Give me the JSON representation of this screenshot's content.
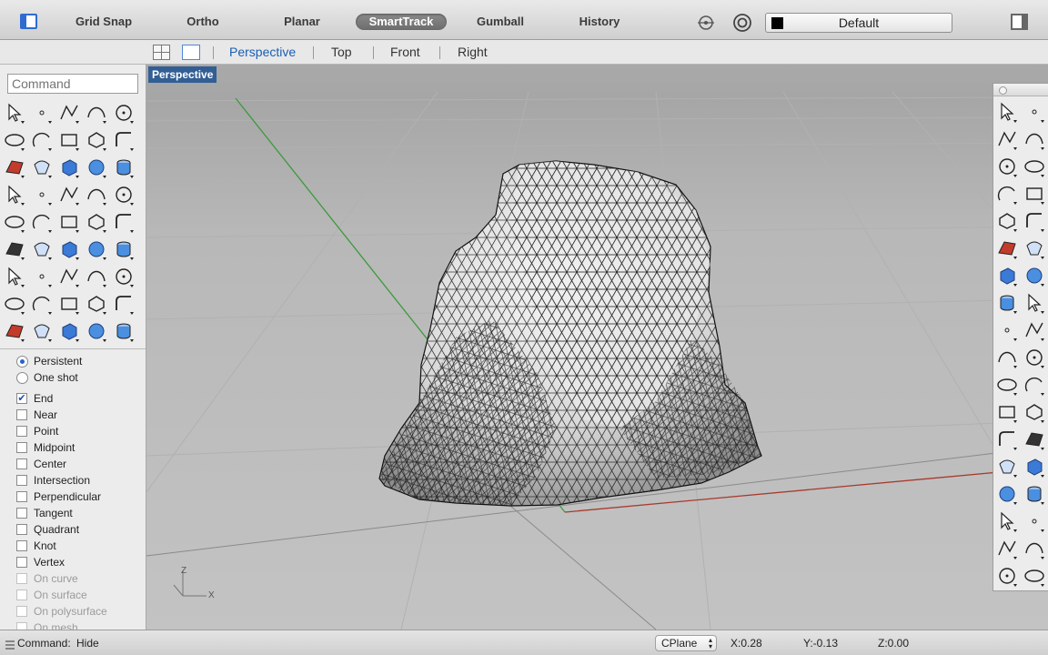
{
  "toolbar": {
    "buttons": [
      "Grid Snap",
      "Ortho",
      "Planar",
      "SmartTrack",
      "Gumball",
      "History"
    ],
    "active": "SmartTrack",
    "layer_name": "Default",
    "icons": [
      "sidebar-toggle-icon",
      "osnap-disc-icon",
      "record-icon",
      "layer-color-swatch",
      "panels-toggle-icon"
    ]
  },
  "viewtabs": {
    "tabs": [
      "Perspective",
      "Top",
      "Front",
      "Right"
    ],
    "active": "Perspective"
  },
  "command": {
    "placeholder": "Command"
  },
  "viewport": {
    "label": "Perspective",
    "axis_z": "Z",
    "axis_x": "X"
  },
  "osnap": {
    "modes": [
      {
        "label": "Persistent",
        "type": "radio",
        "checked": true
      },
      {
        "label": "One shot",
        "type": "radio",
        "checked": false
      }
    ],
    "items": [
      {
        "label": "End",
        "checked": true,
        "enabled": true
      },
      {
        "label": "Near",
        "checked": false,
        "enabled": true
      },
      {
        "label": "Point",
        "checked": false,
        "enabled": true
      },
      {
        "label": "Midpoint",
        "checked": false,
        "enabled": true
      },
      {
        "label": "Center",
        "checked": false,
        "enabled": true
      },
      {
        "label": "Intersection",
        "checked": false,
        "enabled": true
      },
      {
        "label": "Perpendicular",
        "checked": false,
        "enabled": true
      },
      {
        "label": "Tangent",
        "checked": false,
        "enabled": true
      },
      {
        "label": "Quadrant",
        "checked": false,
        "enabled": true
      },
      {
        "label": "Knot",
        "checked": false,
        "enabled": true
      },
      {
        "label": "Vertex",
        "checked": false,
        "enabled": true
      },
      {
        "label": "On curve",
        "checked": false,
        "enabled": false
      },
      {
        "label": "On surface",
        "checked": false,
        "enabled": false
      },
      {
        "label": "On polysurface",
        "checked": false,
        "enabled": false
      },
      {
        "label": "On mesh",
        "checked": false,
        "enabled": false
      }
    ]
  },
  "tools": {
    "left_icons": [
      "select-icon",
      "point-icon",
      "polyline-icon",
      "curve-icon",
      "circle-icon",
      "ellipse-icon",
      "arc-icon",
      "rectangle-icon",
      "polygon-icon",
      "fillet-icon",
      "surface-icon",
      "sweep-icon",
      "box-icon",
      "sphere-icon",
      "cylinder-icon",
      "mesh-icon",
      "gear-icon",
      "explode-icon",
      "trim-icon",
      "split-icon",
      "boolean-icon",
      "group-icon",
      "blend-icon",
      "project-icon",
      "text-icon",
      "transform-icon",
      "array-icon",
      "align-icon",
      "orient-icon",
      "solid-edit-icon",
      "grid-icon",
      "dimension-icon",
      "analyze-icon",
      "check-icon",
      "edge-icon",
      "pan-icon",
      "zoom-in-icon",
      "zoom-window-icon",
      "zoom-extents-icon",
      "zoom-selected-icon",
      "rotate-view-icon",
      "car-icon",
      "render-icon",
      "paint-icon",
      "light-icon"
    ],
    "right_icons": [
      "select-icon",
      "point-icon",
      "polyline-icon",
      "curve-icon",
      "circle-icon",
      "ellipse-icon",
      "arc-icon",
      "rectangle-icon",
      "polygon-icon",
      "fillet-icon",
      "surface-icon",
      "sweep-icon",
      "box-icon",
      "sphere-icon",
      "cylinder-icon",
      "mesh-icon",
      "gear-icon",
      "explode-icon",
      "trim-icon",
      "split-icon",
      "boolean-icon",
      "group-icon",
      "blend-icon",
      "project-icon",
      "text-icon",
      "transform-icon",
      "array-icon",
      "align-icon",
      "orient-icon",
      "solid-edit-icon",
      "grid-icon",
      "dimension-icon",
      "analyze-icon",
      "check-icon",
      "edge-icon",
      "paint-icon"
    ]
  },
  "status": {
    "command_label": "Command:",
    "command_value": "Hide",
    "cplane": "CPlane",
    "x": "X:0.28",
    "y": "Y:-0.13",
    "z": "Z:0.00"
  },
  "colors": {
    "active_tab": "#1a5fb4",
    "viewport_label_bg": "#325e94",
    "x_axis": "#a83a2e",
    "y_axis": "#3c9a3c",
    "smarttrack_on": "#6d6d6d"
  }
}
